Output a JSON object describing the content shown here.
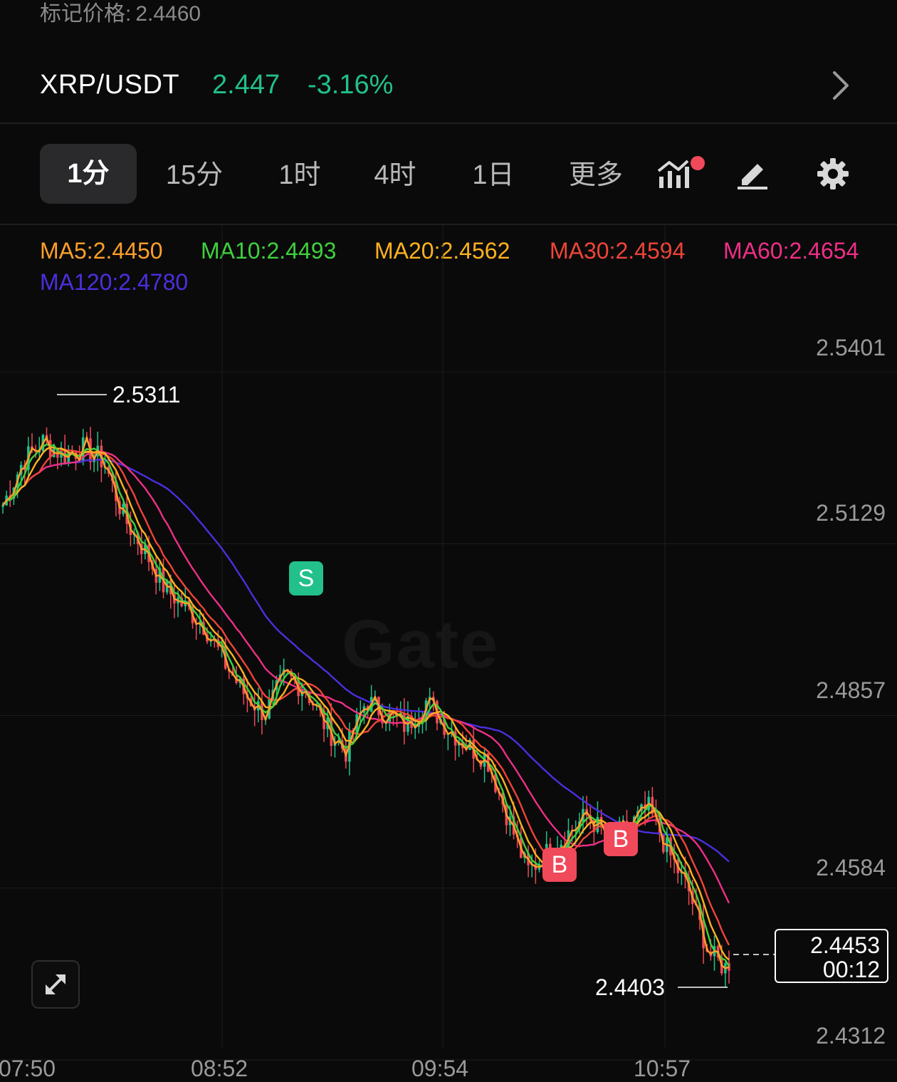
{
  "header": {
    "mark_price_label": "标记价格:",
    "mark_price_value": "2.4460",
    "pair": "XRP/USDT",
    "last_price": "2.447",
    "change_pct": "-3.16%"
  },
  "tabs": [
    "1分",
    "15分",
    "1时",
    "4时",
    "1日",
    "更多"
  ],
  "active_tab": "1分",
  "tools": [
    "indicators-icon",
    "draw-icon",
    "settings-icon"
  ],
  "ma_legend": {
    "ma5": "MA5:2.4450",
    "ma10": "MA10:2.4493",
    "ma20": "MA20:2.4562",
    "ma30": "MA30:2.4594",
    "ma60": "MA60:2.4654",
    "ma120": "MA120:2.4780"
  },
  "colors": {
    "up": "#22c08a",
    "down": "#f0495a",
    "ma5": "#ff9f2a",
    "ma10": "#3ed13e",
    "ma20": "#ffb21f",
    "ma30": "#f04438",
    "ma60": "#ee2f86",
    "ma120": "#4b2fe0"
  },
  "chart_data": {
    "type": "candlestick",
    "y_ticks": [
      "2.5401",
      "2.5129",
      "2.4857",
      "2.4584",
      "2.4312"
    ],
    "ylim": [
      2.4312,
      2.5401
    ],
    "x_ticks": [
      "07:50",
      "08:52",
      "09:54",
      "10:57"
    ],
    "high_marker": "2.5311",
    "low_marker": "2.4403",
    "current_price": "2.4453",
    "countdown": "00:12",
    "signals": [
      {
        "label": "S",
        "type": "sell",
        "price": 2.4955
      },
      {
        "label": "B",
        "type": "buy",
        "price": 2.4575
      },
      {
        "label": "B",
        "type": "buy",
        "price": 2.4615
      }
    ],
    "approx_close_path": [
      2.519,
      2.526,
      2.529,
      2.527,
      2.528,
      2.526,
      2.517,
      2.512,
      2.506,
      2.503,
      2.5,
      2.494,
      2.489,
      2.486,
      2.492,
      2.49,
      2.484,
      2.48,
      2.488,
      2.486,
      2.484,
      2.488,
      2.484,
      2.481,
      2.479,
      2.47,
      2.461,
      2.464,
      2.467,
      2.47,
      2.466,
      2.468,
      2.471,
      2.464,
      2.458,
      2.448,
      2.4453
    ]
  },
  "watermark": "Gate"
}
